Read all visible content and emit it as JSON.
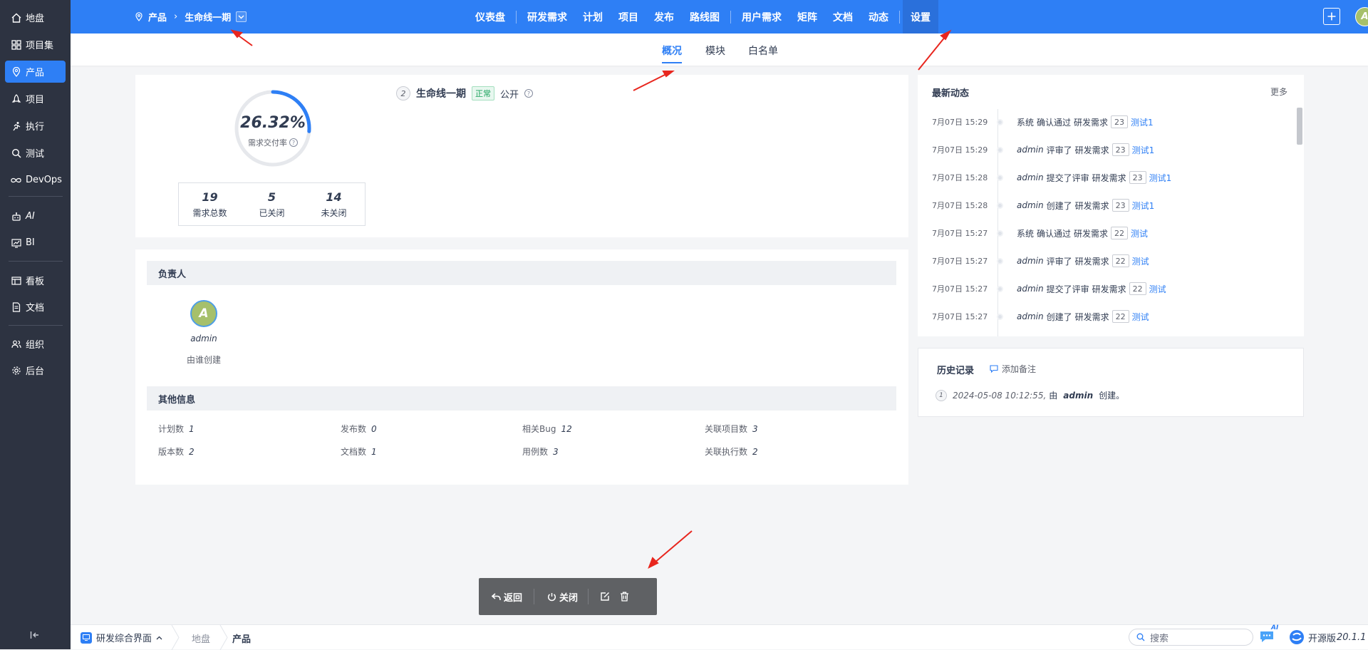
{
  "sidebar": {
    "items": [
      {
        "label": "地盘",
        "icon": "home-icon"
      },
      {
        "label": "项目集",
        "icon": "grid-icon"
      },
      {
        "label": "产品",
        "icon": "location-pin-icon"
      },
      {
        "label": "项目",
        "icon": "rocket-icon"
      },
      {
        "label": "执行",
        "icon": "run-icon"
      },
      {
        "label": "测试",
        "icon": "magnifier-icon"
      },
      {
        "label": "DevOps",
        "icon": "infinity-icon"
      },
      {
        "label": "AI",
        "icon": "robot-icon"
      },
      {
        "label": "BI",
        "icon": "chart-icon"
      },
      {
        "label": "看板",
        "icon": "kanban-icon"
      },
      {
        "label": "文档",
        "icon": "document-icon"
      },
      {
        "label": "组织",
        "icon": "people-icon"
      },
      {
        "label": "后台",
        "icon": "gear-icon"
      }
    ],
    "collapse_icon": "collapse-left-icon"
  },
  "header": {
    "breadcrumb_root": "产品",
    "breadcrumb_current": "生命线一期",
    "nav": [
      "仪表盘",
      "研发需求",
      "计划",
      "项目",
      "发布",
      "路线图",
      "用户需求",
      "矩阵",
      "文档",
      "动态",
      "设置"
    ],
    "avatar_letter": "A"
  },
  "subnav": {
    "tabs": [
      "概况",
      "模块",
      "白名单"
    ],
    "active": "概况"
  },
  "overview": {
    "rate_value": "26.32%",
    "rate_label": "需求交付率",
    "rate_fraction": 0.2632,
    "stats": [
      {
        "value": "19",
        "label": "需求总数"
      },
      {
        "value": "5",
        "label": "已关闭"
      },
      {
        "value": "14",
        "label": "未关闭"
      }
    ],
    "product_no": "2",
    "product_name": "生命线一期",
    "status": "正常",
    "visibility": "公开"
  },
  "owner": {
    "title": "负责人",
    "avatar_letter": "A",
    "name": "admin",
    "role": "由谁创建"
  },
  "other_info": {
    "title": "其他信息",
    "items": [
      {
        "label": "计划数",
        "value": "1"
      },
      {
        "label": "发布数",
        "value": "0"
      },
      {
        "label": "相关Bug",
        "value": "12"
      },
      {
        "label": "关联项目数",
        "value": "3"
      },
      {
        "label": "版本数",
        "value": "2"
      },
      {
        "label": "文档数",
        "value": "1"
      },
      {
        "label": "用例数",
        "value": "3"
      },
      {
        "label": "关联执行数",
        "value": "2"
      }
    ]
  },
  "activity": {
    "title": "最新动态",
    "more": "更多",
    "rows": [
      {
        "time": "7月07日 15:29",
        "who": "系统",
        "action": "确认通过",
        "type": "研发需求",
        "id": "23",
        "target": "测试1"
      },
      {
        "time": "7月07日 15:29",
        "who": "admin",
        "action": "评审了",
        "type": "研发需求",
        "id": "23",
        "target": "测试1"
      },
      {
        "time": "7月07日 15:28",
        "who": "admin",
        "action": "提交了评审",
        "type": "研发需求",
        "id": "23",
        "target": "测试1"
      },
      {
        "time": "7月07日 15:28",
        "who": "admin",
        "action": "创建了",
        "type": "研发需求",
        "id": "23",
        "target": "测试1"
      },
      {
        "time": "7月07日 15:27",
        "who": "系统",
        "action": "确认通过",
        "type": "研发需求",
        "id": "22",
        "target": "测试"
      },
      {
        "time": "7月07日 15:27",
        "who": "admin",
        "action": "评审了",
        "type": "研发需求",
        "id": "22",
        "target": "测试"
      },
      {
        "time": "7月07日 15:27",
        "who": "admin",
        "action": "提交了评审",
        "type": "研发需求",
        "id": "22",
        "target": "测试"
      },
      {
        "time": "7月07日 15:27",
        "who": "admin",
        "action": "创建了",
        "type": "研发需求",
        "id": "22",
        "target": "测试"
      }
    ]
  },
  "history": {
    "title": "历史记录",
    "add_note": "添加备注",
    "entries": [
      {
        "no": "1",
        "time": "2024-05-08 10:12:55,",
        "by": "由",
        "user": "admin",
        "action": "创建。"
      }
    ]
  },
  "toolbar": {
    "back": "返回",
    "close": "关闭"
  },
  "footer": {
    "app_switch": "研发综合界面",
    "crumbs": [
      "地盘",
      "产品"
    ],
    "search_placeholder": "搜索",
    "ai_badge": "AI",
    "edition": "开源版",
    "version": "20.1.1"
  },
  "colors": {
    "primary": "#2e7ff5",
    "sidebar": "#2d3341",
    "success": "#1aa35c",
    "annotation": "#e8261e"
  }
}
